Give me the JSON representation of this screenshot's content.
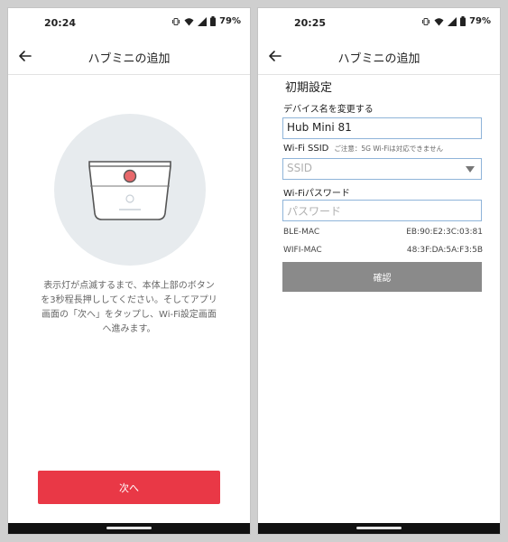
{
  "left_screen": {
    "status": {
      "time": "20:24",
      "battery": "79%"
    },
    "title": "ハブミニの追加",
    "instructions": "表示灯が点滅するまで、本体上部のボタンを3秒程長押ししてください。そしてアプリ画面の「次へ」をタップし、Wi-Fi設定画面へ進みます。",
    "next_button": "次へ",
    "accent_color": "#e93846"
  },
  "right_screen": {
    "status": {
      "time": "20:25",
      "battery": "79%"
    },
    "title": "ハブミニの追加",
    "section_title": "初期設定",
    "device_name_label": "デバイス名を変更する",
    "device_name_value": "Hub Mini 81",
    "wifi_ssid_label": "Wi-Fi SSID",
    "wifi_ssid_note": "ご注意：5G Wi-Fiは対応できません",
    "ssid_placeholder": "SSID",
    "wifi_password_label": "Wi-Fiパスワード",
    "password_placeholder": "パスワード",
    "ble_mac_label": "BLE-MAC",
    "ble_mac_value": "EB:90:E2:3C:03:81",
    "wifi_mac_label": "WIFI-MAC",
    "wifi_mac_value": "48:3F:DA:5A:F3:5B",
    "confirm_button": "確認"
  }
}
